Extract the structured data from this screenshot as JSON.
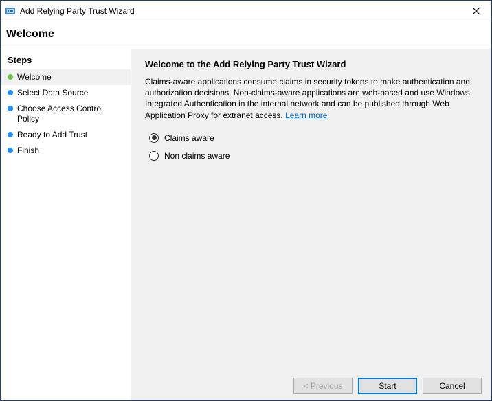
{
  "window": {
    "title": "Add Relying Party Trust Wizard"
  },
  "header": {
    "page_title": "Welcome"
  },
  "sidebar": {
    "title": "Steps",
    "items": [
      {
        "label": "Welcome",
        "active": true,
        "bullet": "green"
      },
      {
        "label": "Select Data Source",
        "active": false,
        "bullet": "blue"
      },
      {
        "label": "Choose Access Control Policy",
        "active": false,
        "bullet": "blue"
      },
      {
        "label": "Ready to Add Trust",
        "active": false,
        "bullet": "blue"
      },
      {
        "label": "Finish",
        "active": false,
        "bullet": "blue"
      }
    ]
  },
  "content": {
    "heading": "Welcome to the Add Relying Party Trust Wizard",
    "description": "Claims-aware applications consume claims in security tokens to make authentication and authorization decisions. Non-claims-aware applications are web-based and use Windows Integrated Authentication in the internal network and can be published through Web Application Proxy for extranet access. ",
    "learn_more": "Learn more",
    "radio_options": [
      {
        "label": "Claims aware",
        "checked": true
      },
      {
        "label": "Non claims aware",
        "checked": false
      }
    ]
  },
  "footer": {
    "previous": "< Previous",
    "start": "Start",
    "cancel": "Cancel"
  }
}
